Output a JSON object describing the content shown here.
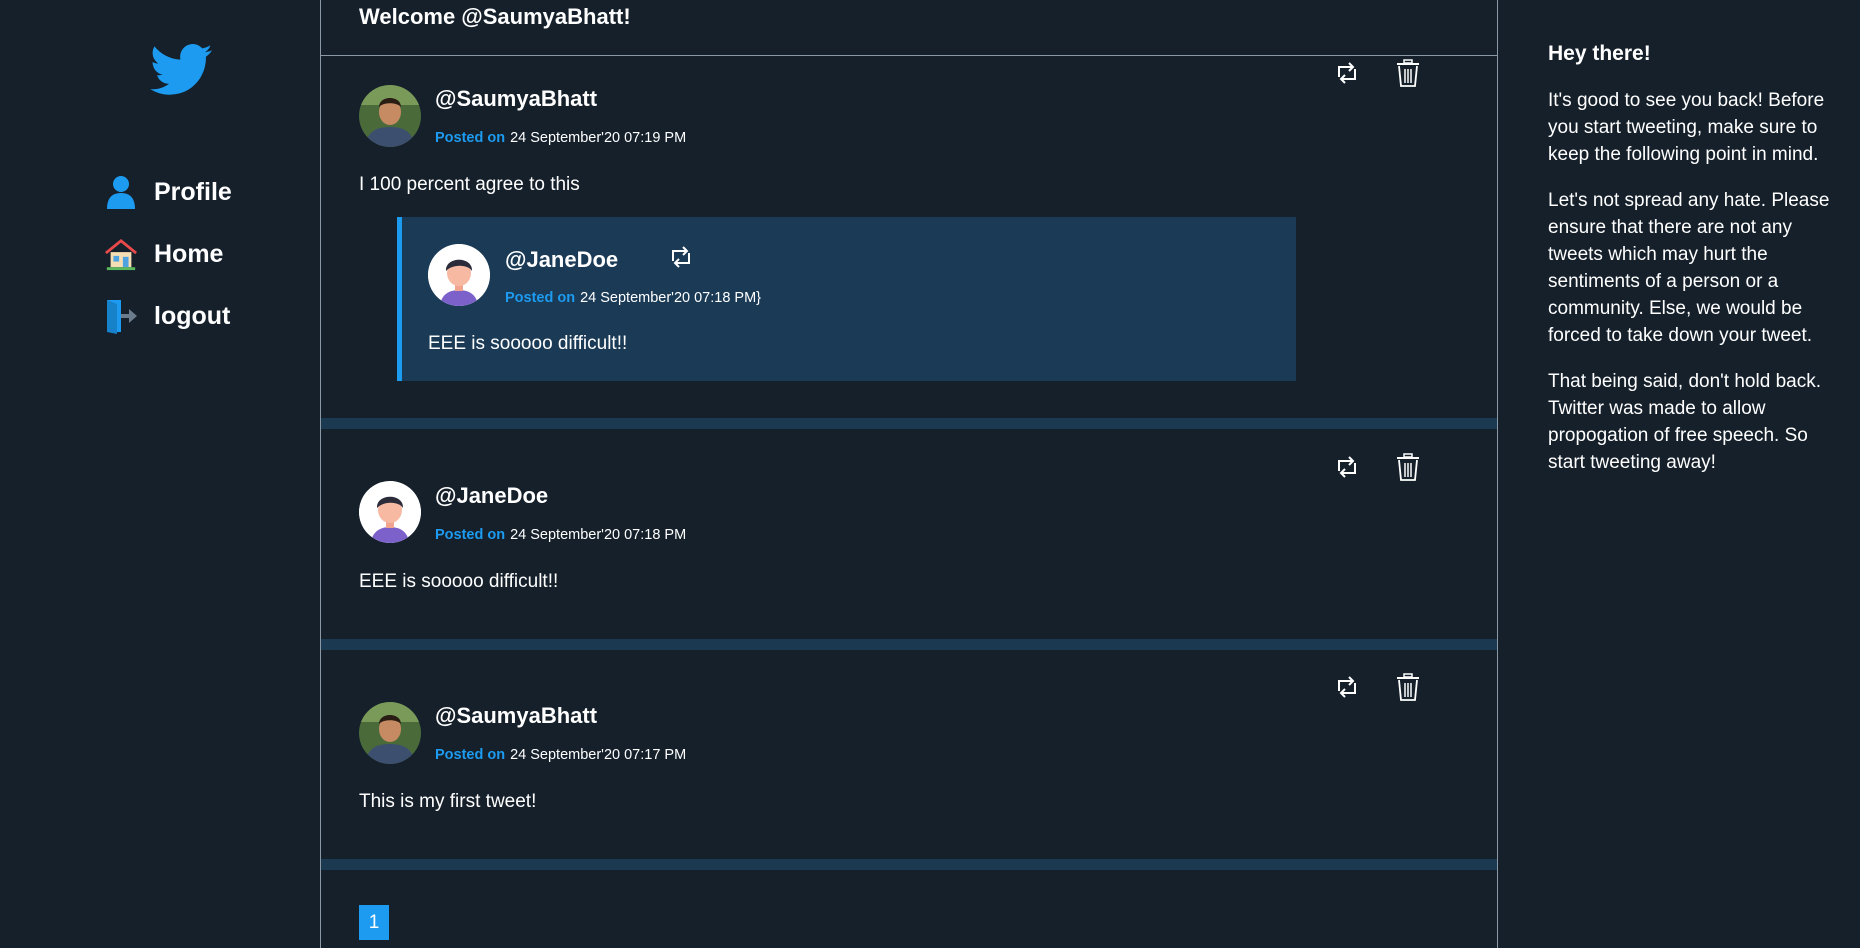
{
  "sidebar": {
    "logo_icon": "twitter-bird-icon",
    "items": [
      {
        "label": "Profile",
        "icon": "user-icon"
      },
      {
        "label": "Home",
        "icon": "home-icon"
      },
      {
        "label": "logout",
        "icon": "logout-icon"
      }
    ]
  },
  "main": {
    "welcome": "Welcome @SaumyaBhatt!",
    "posted_on_label": "Posted on",
    "tweets": [
      {
        "handle": "@SaumyaBhatt",
        "timestamp": "24 September'20 07:19 PM",
        "text": "I 100 percent agree to this",
        "quoted": {
          "handle": "@JaneDoe",
          "timestamp": "24 September'20 07:18 PM}",
          "text": "EEE is sooooo difficult!!"
        }
      },
      {
        "handle": "@JaneDoe",
        "timestamp": "24 September'20 07:18 PM",
        "text": "EEE is sooooo difficult!!"
      },
      {
        "handle": "@SaumyaBhatt",
        "timestamp": "24 September'20 07:17 PM",
        "text": "This is my first tweet!"
      }
    ],
    "pagination": {
      "current_page": "1"
    }
  },
  "right_panel": {
    "heading": "Hey there!",
    "paragraphs": [
      "It's good to see you back! Before you start tweeting, make sure to keep the following point in mind.",
      "Let's not spread any hate. Please ensure that there are not any tweets which may hurt the sentiments of a person or a community. Else, we would be forced to take down your tweet.",
      "That being said, don't hold back. Twitter was made to allow propogation of free speech. So start tweeting away!"
    ]
  },
  "colors": {
    "background": "#15202b",
    "accent": "#1d9bf0",
    "separator": "#1b3a52",
    "quote_background": "#1a3a56"
  }
}
